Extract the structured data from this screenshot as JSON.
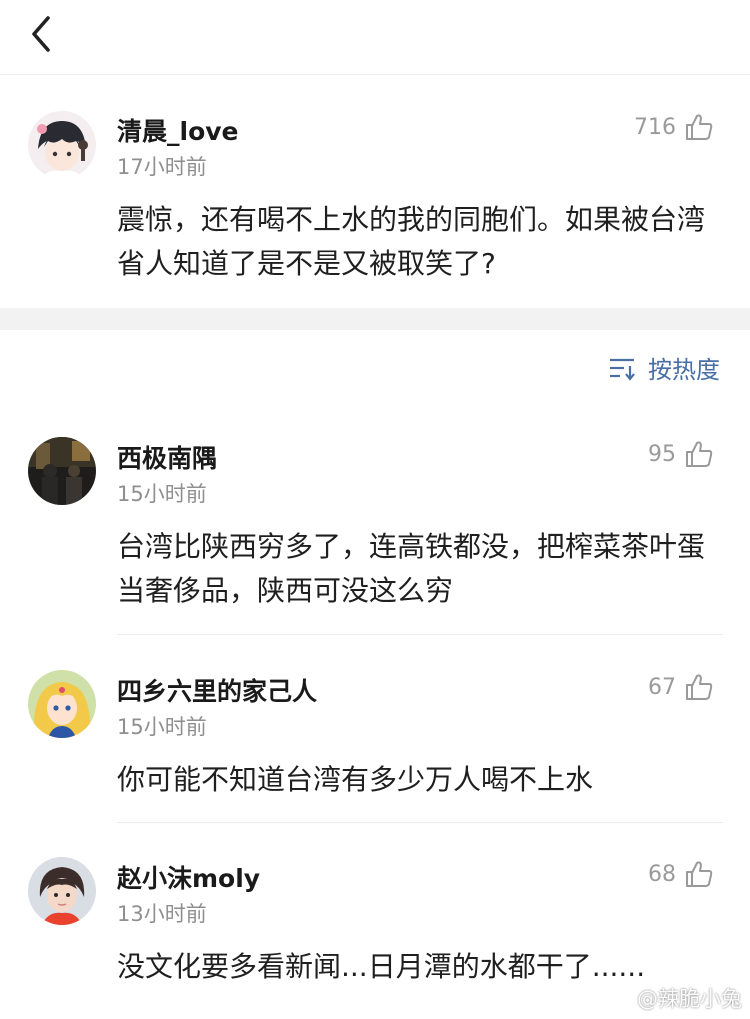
{
  "nav": {
    "back_icon": "chevron-left-icon"
  },
  "main_comment": {
    "username": "清晨_love",
    "time": "17小时前",
    "likes": "716",
    "text": "震惊，还有喝不上水的我的同胞们。如果被台湾省人知道了是不是又被取笑了?"
  },
  "sort": {
    "label": "按热度",
    "icon": "sort-icon"
  },
  "replies": [
    {
      "username": "西极南隅",
      "time": "15小时前",
      "likes": "95",
      "text": "台湾比陕西穷多了，连高铁都没，把榨菜茶叶蛋当奢侈品，陕西可没这么穷"
    },
    {
      "username": "四乡六里的家己人",
      "time": "15小时前",
      "likes": "67",
      "text": "你可能不知道台湾有多少万人喝不上水"
    },
    {
      "username": "赵小沫moly",
      "time": "13小时前",
      "likes": "68",
      "text": "没文化要多看新闻...日月潭的水都干了......"
    }
  ],
  "watermark": {
    "text": "@辣脆小兔",
    "icon": "weibo-icon"
  },
  "colors": {
    "accent": "#4a6fa5",
    "secondary_text": "#8f8f8f",
    "separator": "#f2f2f2"
  }
}
